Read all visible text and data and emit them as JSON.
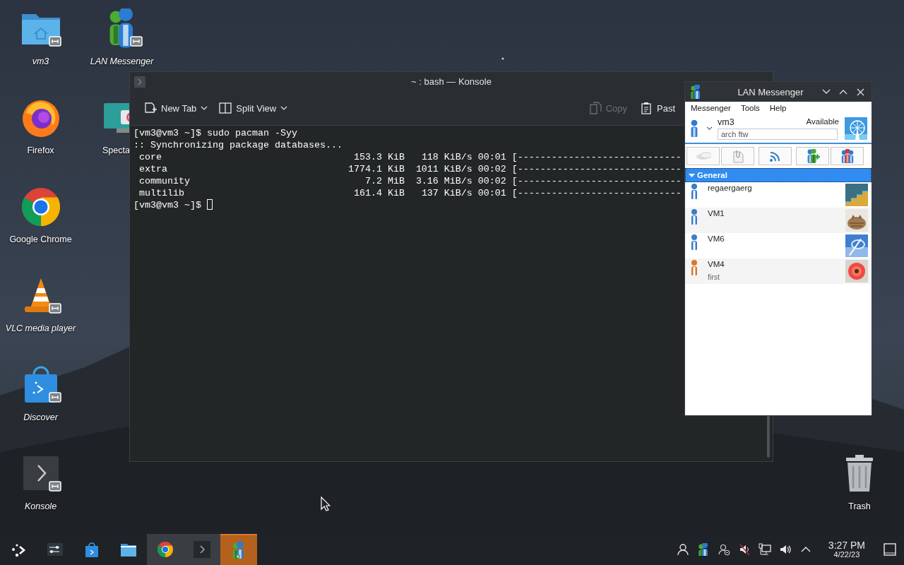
{
  "desktop": {
    "icons": [
      {
        "label": "vm3",
        "kind": "folder",
        "symlink": true,
        "cut_off": false
      },
      {
        "label": "Firefox",
        "kind": "firefox",
        "symlink": false,
        "cut_off": false
      },
      {
        "label": "Google Chrome",
        "kind": "chrome",
        "symlink": false,
        "cut_off": false
      },
      {
        "label": "VLC media player",
        "kind": "vlc",
        "symlink": true,
        "cut_off": false
      },
      {
        "label": "Discover",
        "kind": "discover",
        "symlink": true,
        "cut_off": false
      },
      {
        "label": "Konsole",
        "kind": "konsole",
        "symlink": true,
        "cut_off": false
      },
      {
        "label": "LAN Messenger",
        "kind": "messenger",
        "symlink": true,
        "cut_off": false
      },
      {
        "label": "Specta",
        "kind": "spectacle",
        "symlink": false,
        "cut_off": true
      }
    ],
    "trash": {
      "label": "Trash"
    }
  },
  "konsole": {
    "title": "~ : bash — Konsole",
    "toolbar": [
      {
        "label": "New Tab",
        "kind": "new-tab",
        "disabled": false
      },
      {
        "label": "Split View",
        "kind": "split-view",
        "disabled": false
      },
      {
        "label": "Copy",
        "kind": "copy",
        "disabled": true
      },
      {
        "label": "Past",
        "kind": "paste",
        "disabled": false
      }
    ],
    "terminal": [
      {
        "kind": "text",
        "text": "[vm3@vm3 ~]$ sudo pacman -Syy"
      },
      {
        "kind": "text",
        "text": ":: Synchronizing package databases..."
      },
      {
        "kind": "progress",
        "name": "core",
        "size": "153.3 KiB",
        "speed": "118 KiB/s",
        "time": "00:01",
        "bar": "[-----------------------------"
      },
      {
        "kind": "progress",
        "name": "extra",
        "size": "1774.1 KiB",
        "speed": "1011 KiB/s",
        "time": "00:02",
        "bar": "[-----------------------------"
      },
      {
        "kind": "progress",
        "name": "community",
        "size": "7.2 MiB",
        "speed": "3.16 MiB/s",
        "time": "00:02",
        "bar": "[-----------------------------"
      },
      {
        "kind": "progress",
        "name": "multilib",
        "size": "161.4 KiB",
        "speed": "137 KiB/s",
        "time": "00:01",
        "bar": "[-----------------------------"
      },
      {
        "kind": "prompt",
        "text": "[vm3@vm3 ~]$"
      }
    ]
  },
  "messenger": {
    "title": "LAN Messenger",
    "menu": [
      "Messenger",
      "Tools",
      "Help"
    ],
    "profile": {
      "name": "vm3",
      "status": "Available",
      "note": "arch ftw"
    },
    "toolbar": [
      {
        "kind": "chat"
      },
      {
        "kind": "file"
      },
      {
        "kind": "broadcast"
      },
      {
        "kind": "add-contact"
      },
      {
        "kind": "group"
      }
    ],
    "groups": [
      {
        "name": "General",
        "expanded": true,
        "contacts": [
          {
            "name": "regaergaerg",
            "color": "#3a7cc8"
          },
          {
            "name": "VM1",
            "color": "#3a7cc8"
          },
          {
            "name": "VM6",
            "color": "#3a7cc8"
          },
          {
            "name": "VM4",
            "note": "first",
            "color": "#d9772a"
          }
        ]
      }
    ]
  },
  "taskbar": {
    "tasks": [
      {
        "kind": "launcher",
        "open": false,
        "attention": false
      },
      {
        "kind": "settings",
        "open": false,
        "attention": false
      },
      {
        "kind": "discover",
        "open": false,
        "attention": false
      },
      {
        "kind": "files",
        "open": false,
        "attention": false
      },
      {
        "kind": "chrome",
        "open": true,
        "attention": false
      },
      {
        "kind": "konsole",
        "open": true,
        "attention": false
      },
      {
        "kind": "messenger",
        "open": true,
        "attention": true
      }
    ],
    "tray": [
      {
        "kind": "user"
      },
      {
        "kind": "messenger"
      },
      {
        "kind": "user-away"
      },
      {
        "kind": "muted"
      },
      {
        "kind": "network"
      },
      {
        "kind": "volume"
      },
      {
        "kind": "expand"
      }
    ],
    "time": "3:27 PM",
    "date": "4/22/23"
  }
}
